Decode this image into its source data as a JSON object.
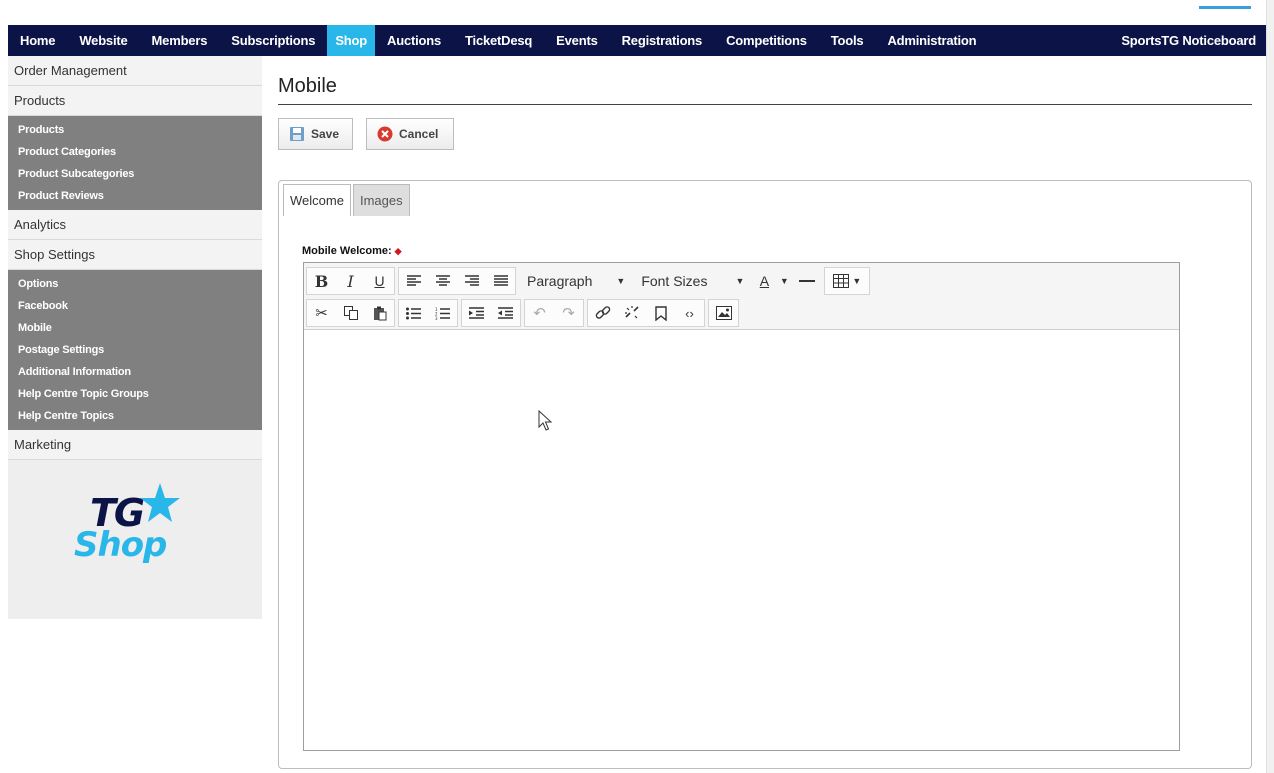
{
  "nav": {
    "items": [
      "Home",
      "Website",
      "Members",
      "Subscriptions",
      "Shop",
      "Auctions",
      "TicketDesq",
      "Events",
      "Registrations",
      "Competitions",
      "Tools",
      "Administration"
    ],
    "active": "Shop",
    "right": "SportsTG Noticeboard"
  },
  "sidebar": {
    "order_management": "Order Management",
    "products": "Products",
    "product_items": [
      "Products",
      "Product Categories",
      "Product Subcategories",
      "Product Reviews"
    ],
    "analytics": "Analytics",
    "shop_settings": "Shop Settings",
    "settings_items": [
      "Options",
      "Facebook",
      "Mobile",
      "Postage Settings",
      "Additional Information",
      "Help Centre Topic Groups",
      "Help Centre Topics"
    ],
    "marketing": "Marketing",
    "logo_tg": "TG",
    "logo_shop": "Shop"
  },
  "main": {
    "title": "Mobile",
    "save": "Save",
    "cancel": "Cancel",
    "tabs": [
      "Welcome",
      "Images"
    ],
    "field_label": "Mobile Welcome:",
    "required_marker": "◆"
  },
  "editor": {
    "bold": "B",
    "italic": "I",
    "underline": "U",
    "format_select": "Paragraph",
    "font_size_select": "Font Sizes",
    "text_color": "A",
    "body_text": ""
  },
  "colors": {
    "nav_bg": "#0c1447",
    "accent": "#29b6e8",
    "sidebar_sub_bg": "#808080"
  }
}
